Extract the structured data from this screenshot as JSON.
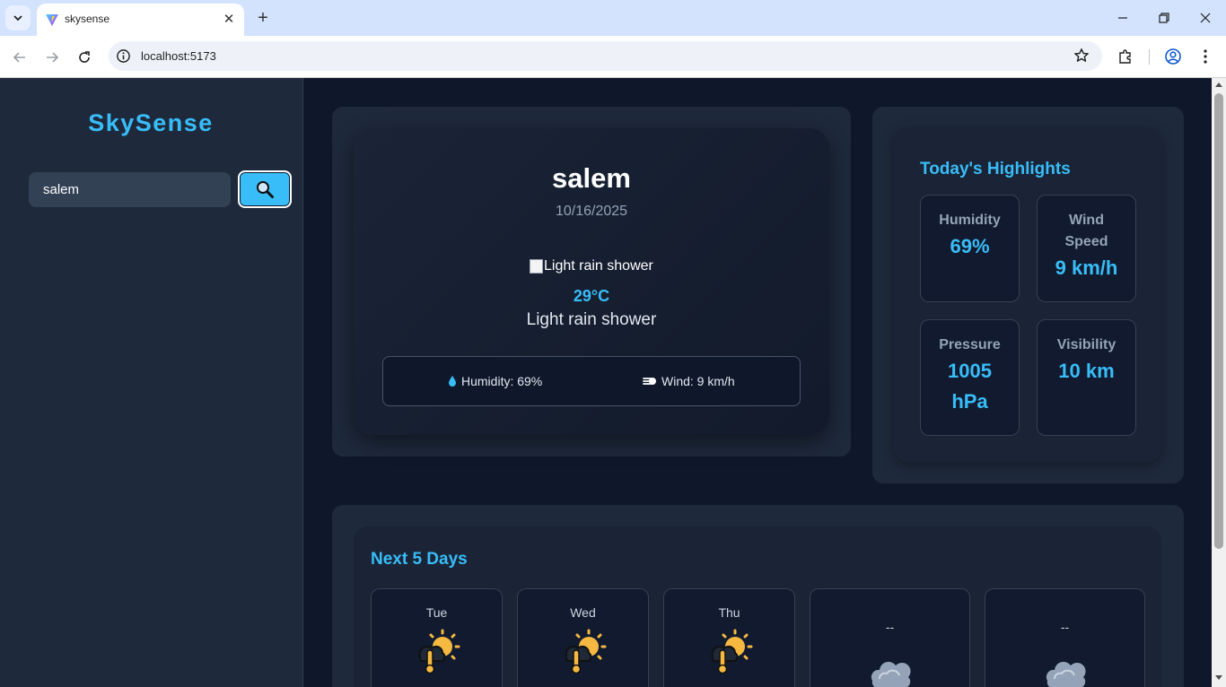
{
  "browser": {
    "tab_title": "skysense",
    "url": "localhost:5173"
  },
  "sidebar": {
    "brand": "SkySense",
    "search_value": "salem",
    "search_icon": "magnifier-icon"
  },
  "current": {
    "city": "salem",
    "date": "10/16/2025",
    "image_alt": "Light rain shower",
    "temperature": "29°C",
    "condition": "Light rain shower",
    "humidity_text": "Humidity: 69%",
    "wind_text": "Wind: 9 km/h"
  },
  "highlights": {
    "title": "Today's Highlights",
    "cards": [
      {
        "label": "Humidity",
        "value": "69%"
      },
      {
        "label": "Wind Speed",
        "value": "9 km/h"
      },
      {
        "label": "Pressure",
        "value": "1005 hPa"
      },
      {
        "label": "Visibility",
        "value": "10 km"
      }
    ]
  },
  "forecast": {
    "title": "Next 5 Days",
    "days": [
      {
        "label": "Tue",
        "icon": "sun-cloud-thermometer-icon"
      },
      {
        "label": "Wed",
        "icon": "sun-cloud-thermometer-icon"
      },
      {
        "label": "Thu",
        "icon": "sun-cloud-thermometer-icon"
      },
      {
        "label": "--",
        "icon": "cloud-icon"
      },
      {
        "label": "--",
        "icon": "cloud-icon"
      }
    ]
  },
  "colors": {
    "accent": "#38bdf8",
    "background": "#0f172a",
    "panel": "#1e293b"
  }
}
